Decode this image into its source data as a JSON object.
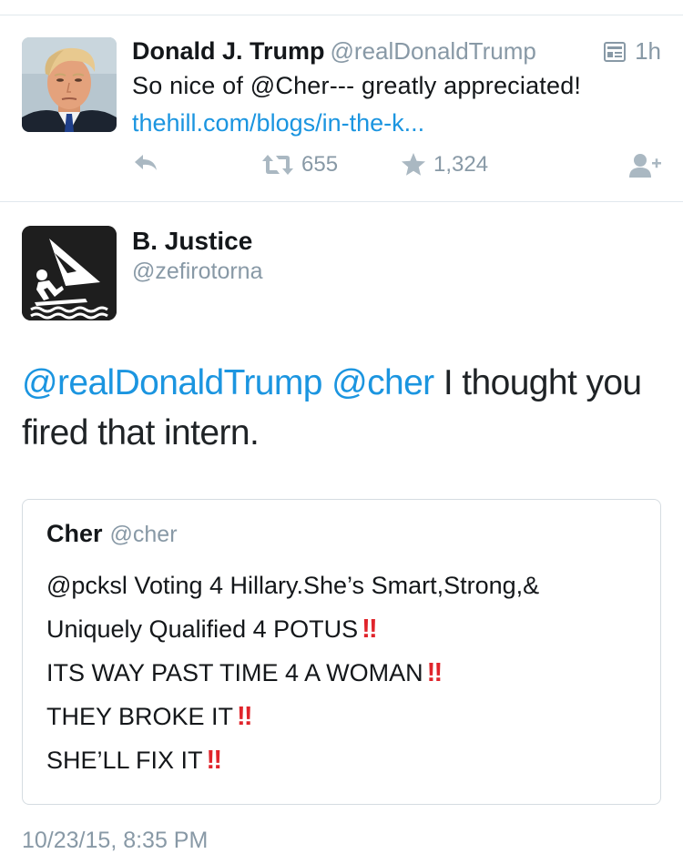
{
  "tweet1": {
    "name": "Donald J. Trump",
    "handle": "@realDonaldTrump",
    "time": "1h",
    "text": "So nice of @Cher--- greatly appreciated!",
    "link": "thehill.com/blogs/in-the-k...",
    "retweets": "655",
    "likes": "1,324",
    "icons": [
      "summary-card-icon",
      "reply-icon",
      "retweet-icon",
      "like-star-icon",
      "follow-icon"
    ]
  },
  "tweet2": {
    "name": "B. Justice",
    "handle": "@zefirotorna",
    "body": {
      "mention1": "@realDonaldTrump",
      "mention2": "@cher",
      "text": "I thought you fired that intern."
    },
    "timestamp": "10/23/15, 8:35 PM"
  },
  "quoted": {
    "name": "Cher",
    "handle": "@cher",
    "lines": [
      {
        "text": "@pcksl Voting 4 Hillary.She’s Smart,Strong,&",
        "emoji": ""
      },
      {
        "text": "Uniquely Qualified 4 POTUS",
        "emoji": "‼"
      },
      {
        "text": "ITS WAY PAST TIME 4 A WOMAN",
        "emoji": "‼"
      },
      {
        "text": "THEY BROKE IT",
        "emoji": "‼"
      },
      {
        "text": "SHE’LL FIX IT",
        "emoji": "‼"
      }
    ]
  },
  "colors": {
    "link_blue": "#1b95e0",
    "muted_gray": "#8899a6",
    "emoji_red": "#e0242b",
    "divider": "#e1e8ed"
  }
}
